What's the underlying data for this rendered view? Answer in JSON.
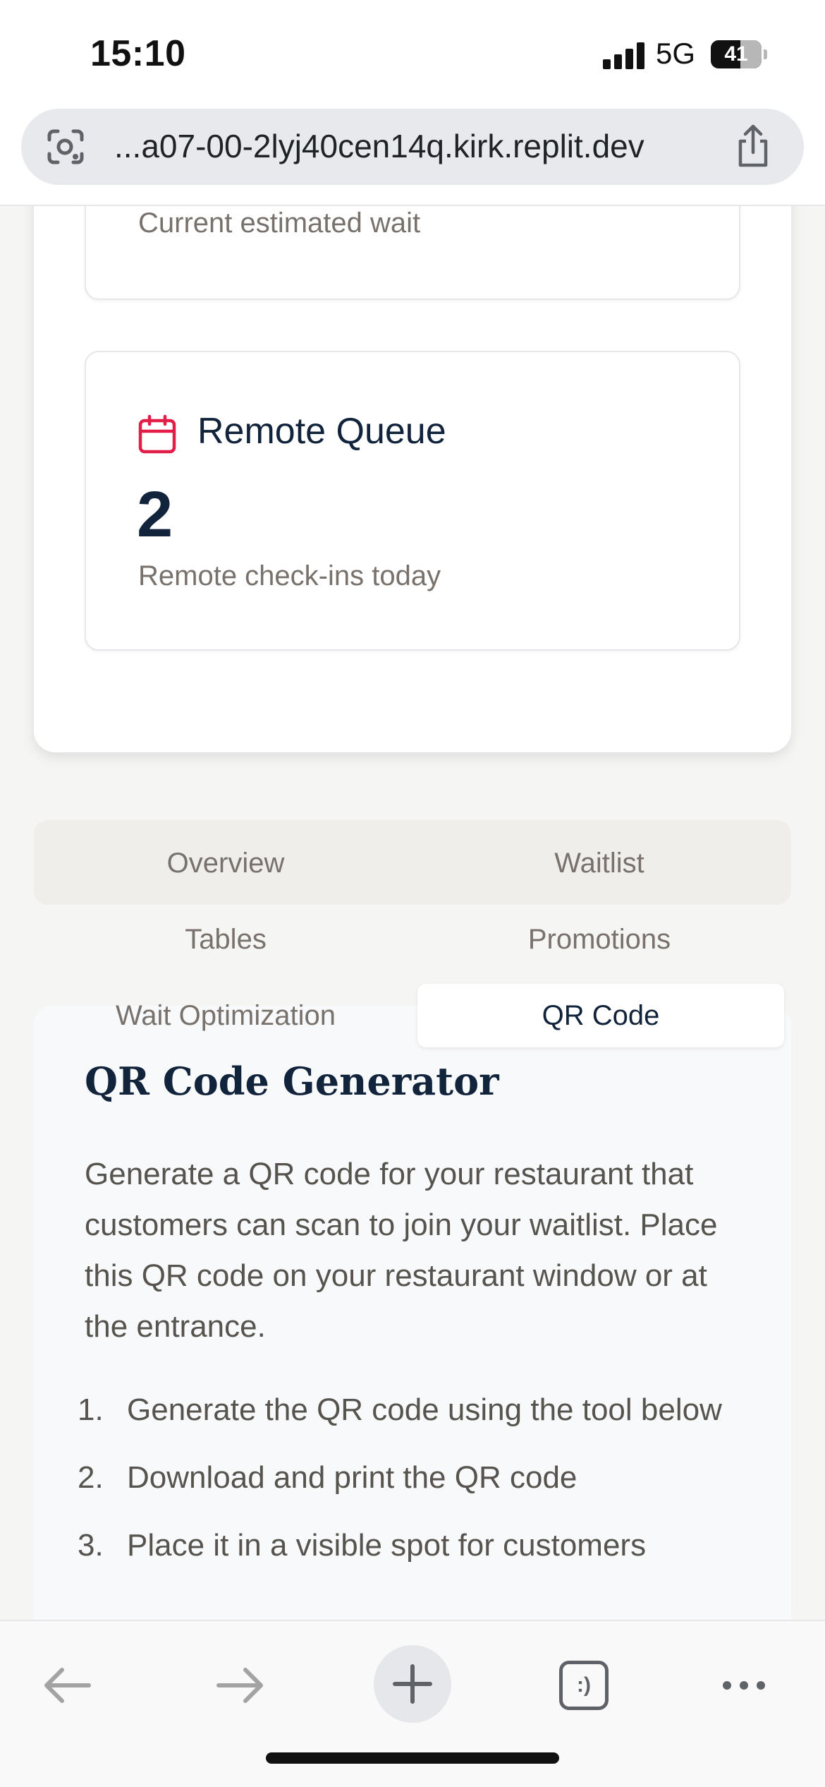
{
  "status_bar": {
    "time": "15:10",
    "network": "5G",
    "battery": "41"
  },
  "browser": {
    "url": "...a07-00-2lyj40cen14q.kirk.replit.dev"
  },
  "stats": {
    "wait": {
      "subtitle": "Current estimated wait"
    },
    "queue": {
      "icon": "calendar-icon",
      "title": "Remote Queue",
      "value": "2",
      "subtitle": "Remote check-ins today"
    }
  },
  "tabs": [
    {
      "label": "Overview",
      "active": false
    },
    {
      "label": "Waitlist",
      "active": false
    },
    {
      "label": "Tables",
      "active": false
    },
    {
      "label": "Promotions",
      "active": false
    },
    {
      "label": "Wait Optimization",
      "active": false
    },
    {
      "label": "QR Code",
      "active": true
    }
  ],
  "qr_section": {
    "title": "QR Code Generator",
    "description": "Generate a QR code for your restaurant that customers can scan to join your waitlist. Place this QR code on your restaurant window or at the entrance.",
    "steps": [
      {
        "num": "1.",
        "text": "Generate the QR code using the tool below"
      },
      {
        "num": "2.",
        "text": "Download and print the QR code"
      },
      {
        "num": "3.",
        "text": "Place it in a visible spot for customers"
      }
    ]
  },
  "toolbar": {
    "icons": [
      "back-arrow-icon",
      "forward-arrow-icon",
      "new-tab-plus-icon",
      "tabs-icon",
      "more-icon"
    ],
    "tabs_glyph": ":)"
  },
  "colors": {
    "accent_red": "#e11d48",
    "navy": "#12243b",
    "muted": "#78716c"
  }
}
